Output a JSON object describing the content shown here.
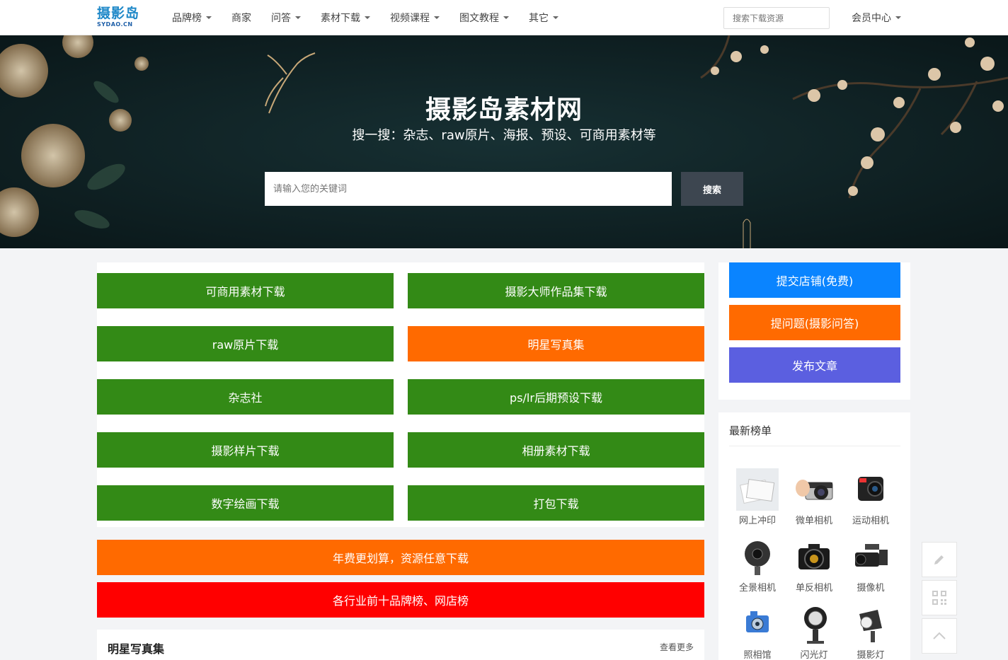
{
  "header": {
    "logo_cn": "摄影岛",
    "logo_en": "SYDAO.CN",
    "nav": [
      {
        "label": "品牌榜",
        "dropdown": true
      },
      {
        "label": "商家",
        "dropdown": false
      },
      {
        "label": "问答",
        "dropdown": true
      },
      {
        "label": "素材下载",
        "dropdown": true
      },
      {
        "label": "视频课程",
        "dropdown": true
      },
      {
        "label": "图文教程",
        "dropdown": true
      },
      {
        "label": "其它",
        "dropdown": true
      }
    ],
    "search_placeholder": "搜索下载资源",
    "member": "会员中心"
  },
  "banner": {
    "title": "摄影岛素材网",
    "subtitle": "搜一搜：杂志、raw原片、海报、预设、可商用素材等",
    "search_placeholder": "请输入您的关键词",
    "search_button": "搜索"
  },
  "categories": [
    {
      "label": "可商用素材下载",
      "color": "#338a16"
    },
    {
      "label": "摄影大师作品集下载",
      "color": "#338a16"
    },
    {
      "label": "raw原片下载",
      "color": "#338a16"
    },
    {
      "label": "明星写真集",
      "color": "#ff6a00"
    },
    {
      "label": "杂志社",
      "color": "#338a16"
    },
    {
      "label": "ps/lr后期预设下载",
      "color": "#338a16"
    },
    {
      "label": "摄影样片下载",
      "color": "#338a16"
    },
    {
      "label": "相册素材下载",
      "color": "#338a16"
    },
    {
      "label": "数字绘画下载",
      "color": "#338a16"
    },
    {
      "label": "打包下载",
      "color": "#338a16"
    }
  ],
  "wide_buttons": [
    {
      "label": "年费更划算，资源任意下载",
      "color": "#ff6a00"
    },
    {
      "label": "各行业前十品牌榜、网店榜",
      "color": "#ff0000"
    }
  ],
  "section": {
    "title": "明星写真集",
    "more": "查看更多"
  },
  "sidebar": {
    "actions": [
      {
        "label": "提交店铺(免费)",
        "color": "#0a84ff"
      },
      {
        "label": "提问题(摄影问答)",
        "color": "#ff6a00"
      },
      {
        "label": "发布文章",
        "color": "#5b5fe0"
      }
    ],
    "rank_title": "最新榜单",
    "rank_items": [
      {
        "label": "网上冲印",
        "icon": "photo-print-icon"
      },
      {
        "label": "微单相机",
        "icon": "mirrorless-camera-icon"
      },
      {
        "label": "运动相机",
        "icon": "action-camera-icon"
      },
      {
        "label": "全景相机",
        "icon": "panorama-camera-icon"
      },
      {
        "label": "单反相机",
        "icon": "dslr-camera-icon"
      },
      {
        "label": "摄像机",
        "icon": "camcorder-icon"
      },
      {
        "label": "照相馆",
        "icon": "photo-studio-icon"
      },
      {
        "label": "闪光灯",
        "icon": "flash-icon"
      },
      {
        "label": "摄影灯",
        "icon": "studio-light-icon"
      }
    ]
  },
  "floating_tools": [
    {
      "icon": "pencil-icon"
    },
    {
      "icon": "qrcode-icon"
    },
    {
      "icon": "back-to-top-icon"
    }
  ]
}
